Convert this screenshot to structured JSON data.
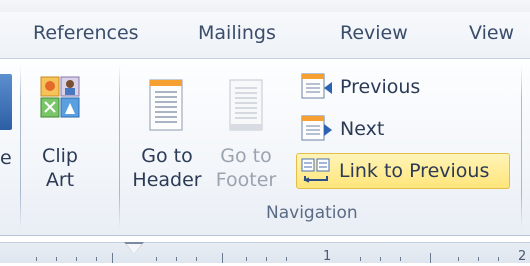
{
  "tabs": [
    {
      "label": "References"
    },
    {
      "label": "Mailings"
    },
    {
      "label": "Review"
    },
    {
      "label": "View"
    }
  ],
  "partial_label": "e",
  "clip_art": {
    "line1": "Clip",
    "line2": "Art",
    "icon": "clip-art-icon"
  },
  "go_to_header": {
    "line1": "Go to",
    "line2": "Header",
    "icon": "page-header-icon"
  },
  "go_to_footer": {
    "line1": "Go to",
    "line2": "Footer",
    "icon": "page-footer-icon",
    "disabled": true
  },
  "previous": {
    "label": "Previous",
    "icon": "previous-section-icon"
  },
  "next": {
    "label": "Next",
    "icon": "next-section-icon"
  },
  "link_to_previous": {
    "label": "Link to Previous",
    "icon": "link-to-previous-icon",
    "active": true
  },
  "group_label": "Navigation",
  "ruler": {
    "numbers": [
      "1",
      "2"
    ]
  },
  "colors": {
    "accent": "#ffe57a",
    "text": "#2b3a55",
    "disabled": "#9aa3ae"
  }
}
